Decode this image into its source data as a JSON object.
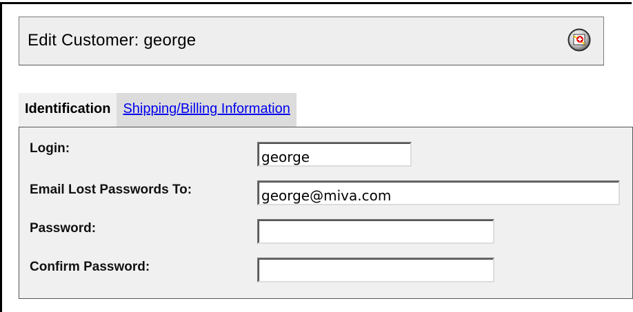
{
  "header": {
    "title": "Edit Customer: george",
    "help_icon": "help-icon"
  },
  "tabs": [
    {
      "label": "Identification",
      "active": true
    },
    {
      "label": "Shipping/Billing Information",
      "active": false
    }
  ],
  "form": {
    "login": {
      "label": "Login:",
      "value": "george",
      "placeholder": ""
    },
    "email": {
      "label": "Email Lost Passwords To:",
      "value": "george@miva.com",
      "placeholder": ""
    },
    "password": {
      "label": "Password:",
      "value": "",
      "placeholder": ""
    },
    "confirm_password": {
      "label": "Confirm Password:",
      "value": "",
      "placeholder": ""
    }
  },
  "colors": {
    "link": "#0000ee",
    "panel_bg": "#f0f0f0",
    "title_bg": "#eeeeee",
    "inactive_tab_bg": "#dcdcdc"
  }
}
